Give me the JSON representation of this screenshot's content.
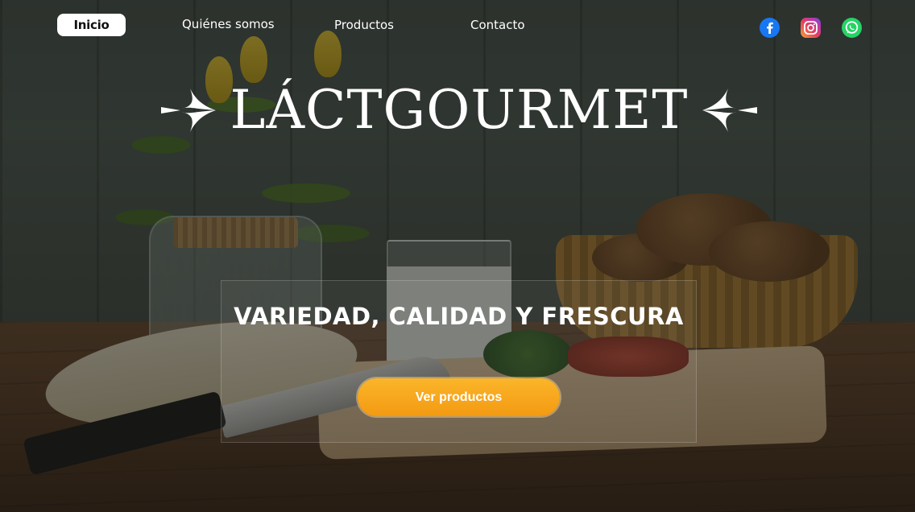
{
  "nav": {
    "links": [
      {
        "label": "Inicio",
        "active": true
      },
      {
        "label": "Quiénes somos"
      },
      {
        "label": "Productos"
      },
      {
        "label": "Contacto"
      }
    ]
  },
  "social": [
    {
      "icon": "facebook-icon",
      "color": "#1877f2"
    },
    {
      "icon": "instagram-icon",
      "color": "#e7405a"
    },
    {
      "icon": "whatsapp-icon",
      "color": "#25d366"
    }
  ],
  "brand": {
    "title": "LÁCTGOURMET"
  },
  "hero": {
    "tagline": "VARIEDAD, CALIDAD Y FRESCURA",
    "cta_label": "Ver productos",
    "cta_color": "#f7a51f"
  }
}
